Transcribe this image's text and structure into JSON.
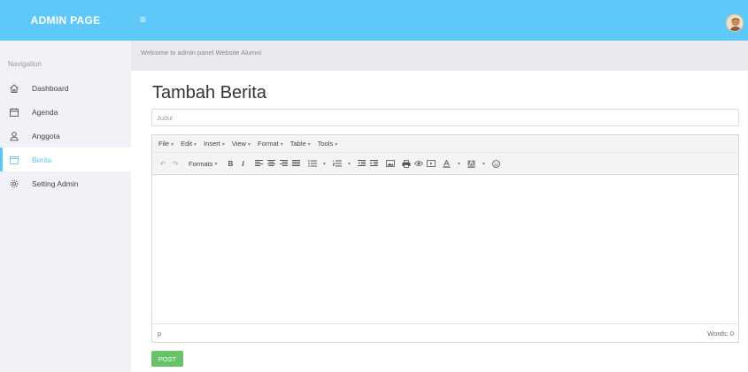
{
  "header": {
    "brand": "ADMIN PAGE",
    "menu_toggle_icon": "hamburger-icon",
    "accent_color": "#5ec8f8"
  },
  "sidebar": {
    "heading": "Navigation",
    "items": [
      {
        "label": "Dashboard",
        "icon": "home-icon"
      },
      {
        "label": "Agenda",
        "icon": "calendar-icon"
      },
      {
        "label": "Anggota",
        "icon": "user-icon"
      },
      {
        "label": "Berita",
        "icon": "newspaper-icon",
        "active": true
      },
      {
        "label": "Setting Admin",
        "icon": "gear-icon"
      }
    ]
  },
  "welcome": "Welcome to admin panel Website Alumni",
  "page": {
    "title": "Tambah Berita",
    "title_placeholder": "Judul"
  },
  "editor": {
    "menus": [
      "File",
      "Edit",
      "Insert",
      "View",
      "Format",
      "Table",
      "Tools"
    ],
    "formats_label": "Formats",
    "bold_label": "B",
    "italic_label": "I",
    "status_path": "p",
    "word_count": "Words: 0"
  },
  "post_button": "POST",
  "button_color": "#66c466"
}
